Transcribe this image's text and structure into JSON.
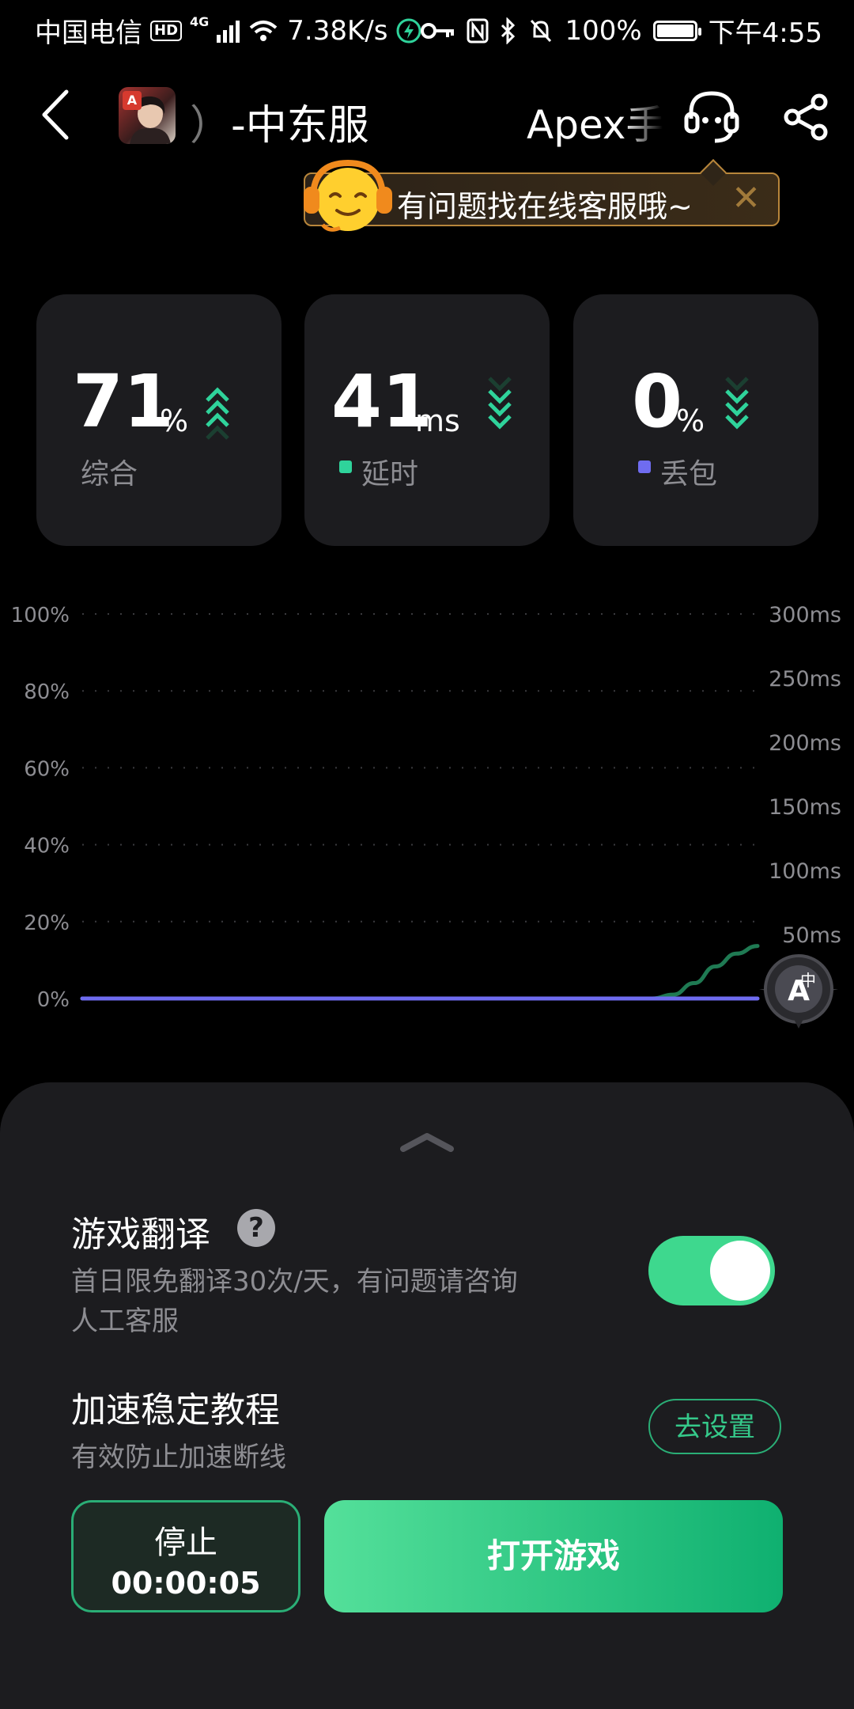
{
  "status_bar": {
    "carrier": "中国电信",
    "hd": "HD",
    "net_type": "4G",
    "speed": "7.38K/s",
    "battery_pct": "100%",
    "time": "下午4:55"
  },
  "header": {
    "title_paren": "）",
    "title": "-中东服",
    "game_name_partial": "Apex手"
  },
  "tooltip": {
    "text": "有问题找在线客服哦~",
    "close": "✕"
  },
  "stats": [
    {
      "value": "71",
      "unit": "%",
      "label": "综合",
      "color": ""
    },
    {
      "value": "41",
      "unit": "ms",
      "label": "延时",
      "color": "#2fd39b"
    },
    {
      "value": "0",
      "unit": "%",
      "label": "丢包",
      "color": "#6f6cf0"
    }
  ],
  "chart_data": {
    "type": "line",
    "y_left_ticks": [
      "100%",
      "80%",
      "60%",
      "40%",
      "20%",
      "0%"
    ],
    "y_right_ticks": [
      "300ms",
      "250ms",
      "200ms",
      "150ms",
      "100ms",
      "50ms"
    ],
    "y_left_range": [
      0,
      100
    ],
    "y_right_range": [
      0,
      300
    ],
    "grid": true,
    "series": [
      {
        "axis": "right",
        "color": "#1f7a53",
        "values": [
          0,
          0,
          0,
          0,
          0,
          0,
          0,
          0,
          0,
          0,
          0,
          0,
          0,
          0,
          0,
          0,
          0,
          0,
          0,
          0,
          0,
          0,
          0,
          0,
          0,
          0,
          0,
          0,
          3,
          12,
          25,
          35,
          41
        ]
      },
      {
        "axis": "left",
        "color": "#6f6cf0",
        "values": [
          0,
          0,
          0,
          0,
          0,
          0,
          0,
          0,
          0,
          0,
          0,
          0,
          0,
          0,
          0,
          0,
          0,
          0,
          0,
          0,
          0,
          0,
          0,
          0,
          0,
          0,
          0,
          0,
          0,
          0,
          0,
          0,
          0
        ]
      }
    ]
  },
  "translate": {
    "title": "游戏翻译",
    "help": "?",
    "desc_line1": "首日限免翻译30次/天，有问题请咨询",
    "desc_line2": "人工客服",
    "enabled": true
  },
  "tutorial": {
    "title": "加速稳定教程",
    "desc": "有效防止加速断线",
    "button": "去设置"
  },
  "actions": {
    "stop_label": "停止",
    "timer": "00:00:05",
    "open_label": "打开游戏"
  },
  "colors": {
    "accent": "#3ed88e",
    "card_bg": "#1c1c1f"
  }
}
